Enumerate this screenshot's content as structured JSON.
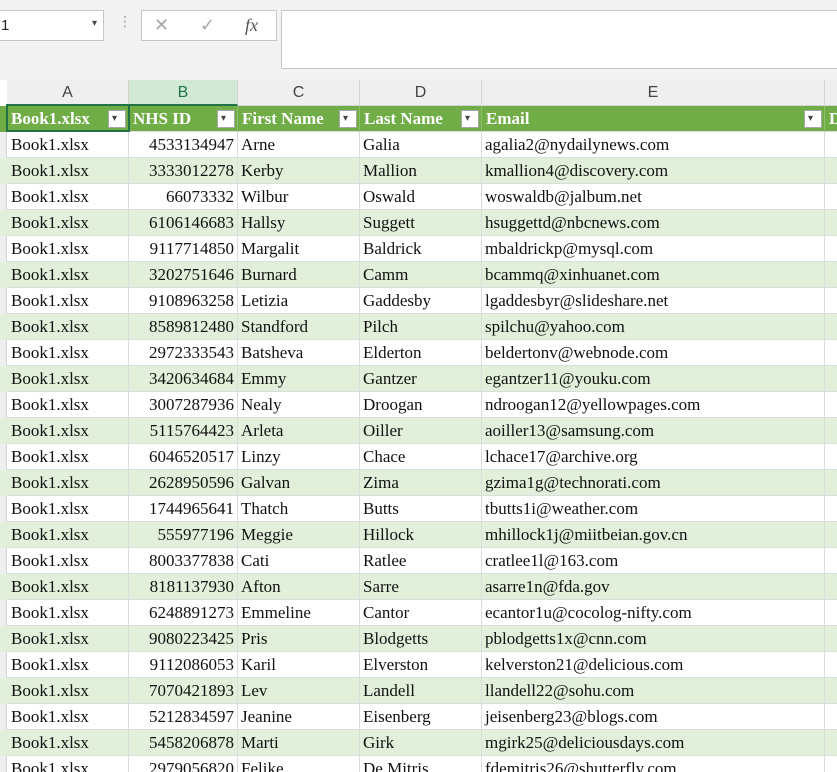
{
  "formula_bar": {
    "name_box": "1",
    "grip": "⋮",
    "cancel": "✕",
    "enter": "✓",
    "fx": "fx",
    "formula": ""
  },
  "columns": [
    "A",
    "B",
    "C",
    "D",
    "E"
  ],
  "table_headers": [
    "Book1.xlsx",
    "NHS ID",
    "First Name",
    "Last Name",
    "Email",
    "D"
  ],
  "rows": [
    [
      "Book1.xlsx",
      "4533134947",
      "Arne",
      "Galia",
      "agalia2@nydailynews.com"
    ],
    [
      "Book1.xlsx",
      "3333012278",
      "Kerby",
      "Mallion",
      "kmallion4@discovery.com"
    ],
    [
      "Book1.xlsx",
      "66073332",
      "Wilbur",
      "Oswald",
      "woswaldb@jalbum.net"
    ],
    [
      "Book1.xlsx",
      "6106146683",
      "Hallsy",
      "Suggett",
      "hsuggettd@nbcnews.com"
    ],
    [
      "Book1.xlsx",
      "9117714850",
      "Margalit",
      "Baldrick",
      "mbaldrickp@mysql.com"
    ],
    [
      "Book1.xlsx",
      "3202751646",
      "Burnard",
      "Camm",
      "bcammq@xinhuanet.com"
    ],
    [
      "Book1.xlsx",
      "9108963258",
      "Letizia",
      "Gaddesby",
      "lgaddesbyr@slideshare.net"
    ],
    [
      "Book1.xlsx",
      "8589812480",
      "Standford",
      "Pilch",
      "spilchu@yahoo.com"
    ],
    [
      "Book1.xlsx",
      "2972333543",
      "Batsheva",
      "Elderton",
      "beldertonv@webnode.com"
    ],
    [
      "Book1.xlsx",
      "3420634684",
      "Emmy",
      "Gantzer",
      "egantzer11@youku.com"
    ],
    [
      "Book1.xlsx",
      "3007287936",
      "Nealy",
      "Droogan",
      "ndroogan12@yellowpages.com"
    ],
    [
      "Book1.xlsx",
      "5115764423",
      "Arleta",
      "Oiller",
      "aoiller13@samsung.com"
    ],
    [
      "Book1.xlsx",
      "6046520517",
      "Linzy",
      "Chace",
      "lchace17@archive.org"
    ],
    [
      "Book1.xlsx",
      "2628950596",
      "Galvan",
      "Zima",
      "gzima1g@technorati.com"
    ],
    [
      "Book1.xlsx",
      "1744965641",
      "Thatch",
      "Butts",
      "tbutts1i@weather.com"
    ],
    [
      "Book1.xlsx",
      "555977196",
      "Meggie",
      "Hillock",
      "mhillock1j@miitbeian.gov.cn"
    ],
    [
      "Book1.xlsx",
      "8003377838",
      "Cati",
      "Ratlee",
      "cratlee1l@163.com"
    ],
    [
      "Book1.xlsx",
      "8181137930",
      "Afton",
      "Sarre",
      "asarre1n@fda.gov"
    ],
    [
      "Book1.xlsx",
      "6248891273",
      "Emmeline",
      "Cantor",
      "ecantor1u@cocolog-nifty.com"
    ],
    [
      "Book1.xlsx",
      "9080223425",
      "Pris",
      "Blodgetts",
      "pblodgetts1x@cnn.com"
    ],
    [
      "Book1.xlsx",
      "9112086053",
      "Karil",
      "Elverston",
      "kelverston21@delicious.com"
    ],
    [
      "Book1.xlsx",
      "7070421893",
      "Lev",
      "Landell",
      "llandell22@sohu.com"
    ],
    [
      "Book1.xlsx",
      "5212834597",
      "Jeanine",
      "Eisenberg",
      "jeisenberg23@blogs.com"
    ],
    [
      "Book1.xlsx",
      "5458206878",
      "Marti",
      "Girk",
      "mgirk25@deliciousdays.com"
    ],
    [
      "Book1.xlsx",
      "2979056820",
      "Felike",
      "De Mitris",
      "fdemitris26@shutterfly.com"
    ]
  ],
  "colors": {
    "header_green": "#70ad47",
    "band_green": "#e2efda",
    "selection": "#217346"
  }
}
